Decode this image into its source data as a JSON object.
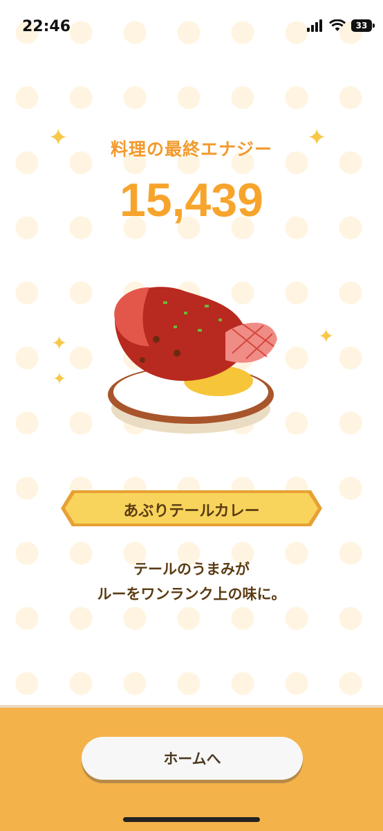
{
  "status_bar": {
    "time": "22:46",
    "battery_level": "33"
  },
  "result": {
    "title": "料理の最終エナジー",
    "energy": "15,439"
  },
  "dish": {
    "name": "あぶりテールカレー",
    "description_line1": "テールのうまみが",
    "description_line2": "ルーをワンランク上の味に。"
  },
  "actions": {
    "home_label": "ホームへ"
  },
  "colors": {
    "accent_orange": "#f29a2c",
    "panel": "#f4b24a",
    "name_plate": "#f8d45c",
    "text_brown": "#5a3b12"
  },
  "icons": [
    "cellular-signal-icon",
    "wifi-icon",
    "battery-icon",
    "sparkle-icon"
  ]
}
